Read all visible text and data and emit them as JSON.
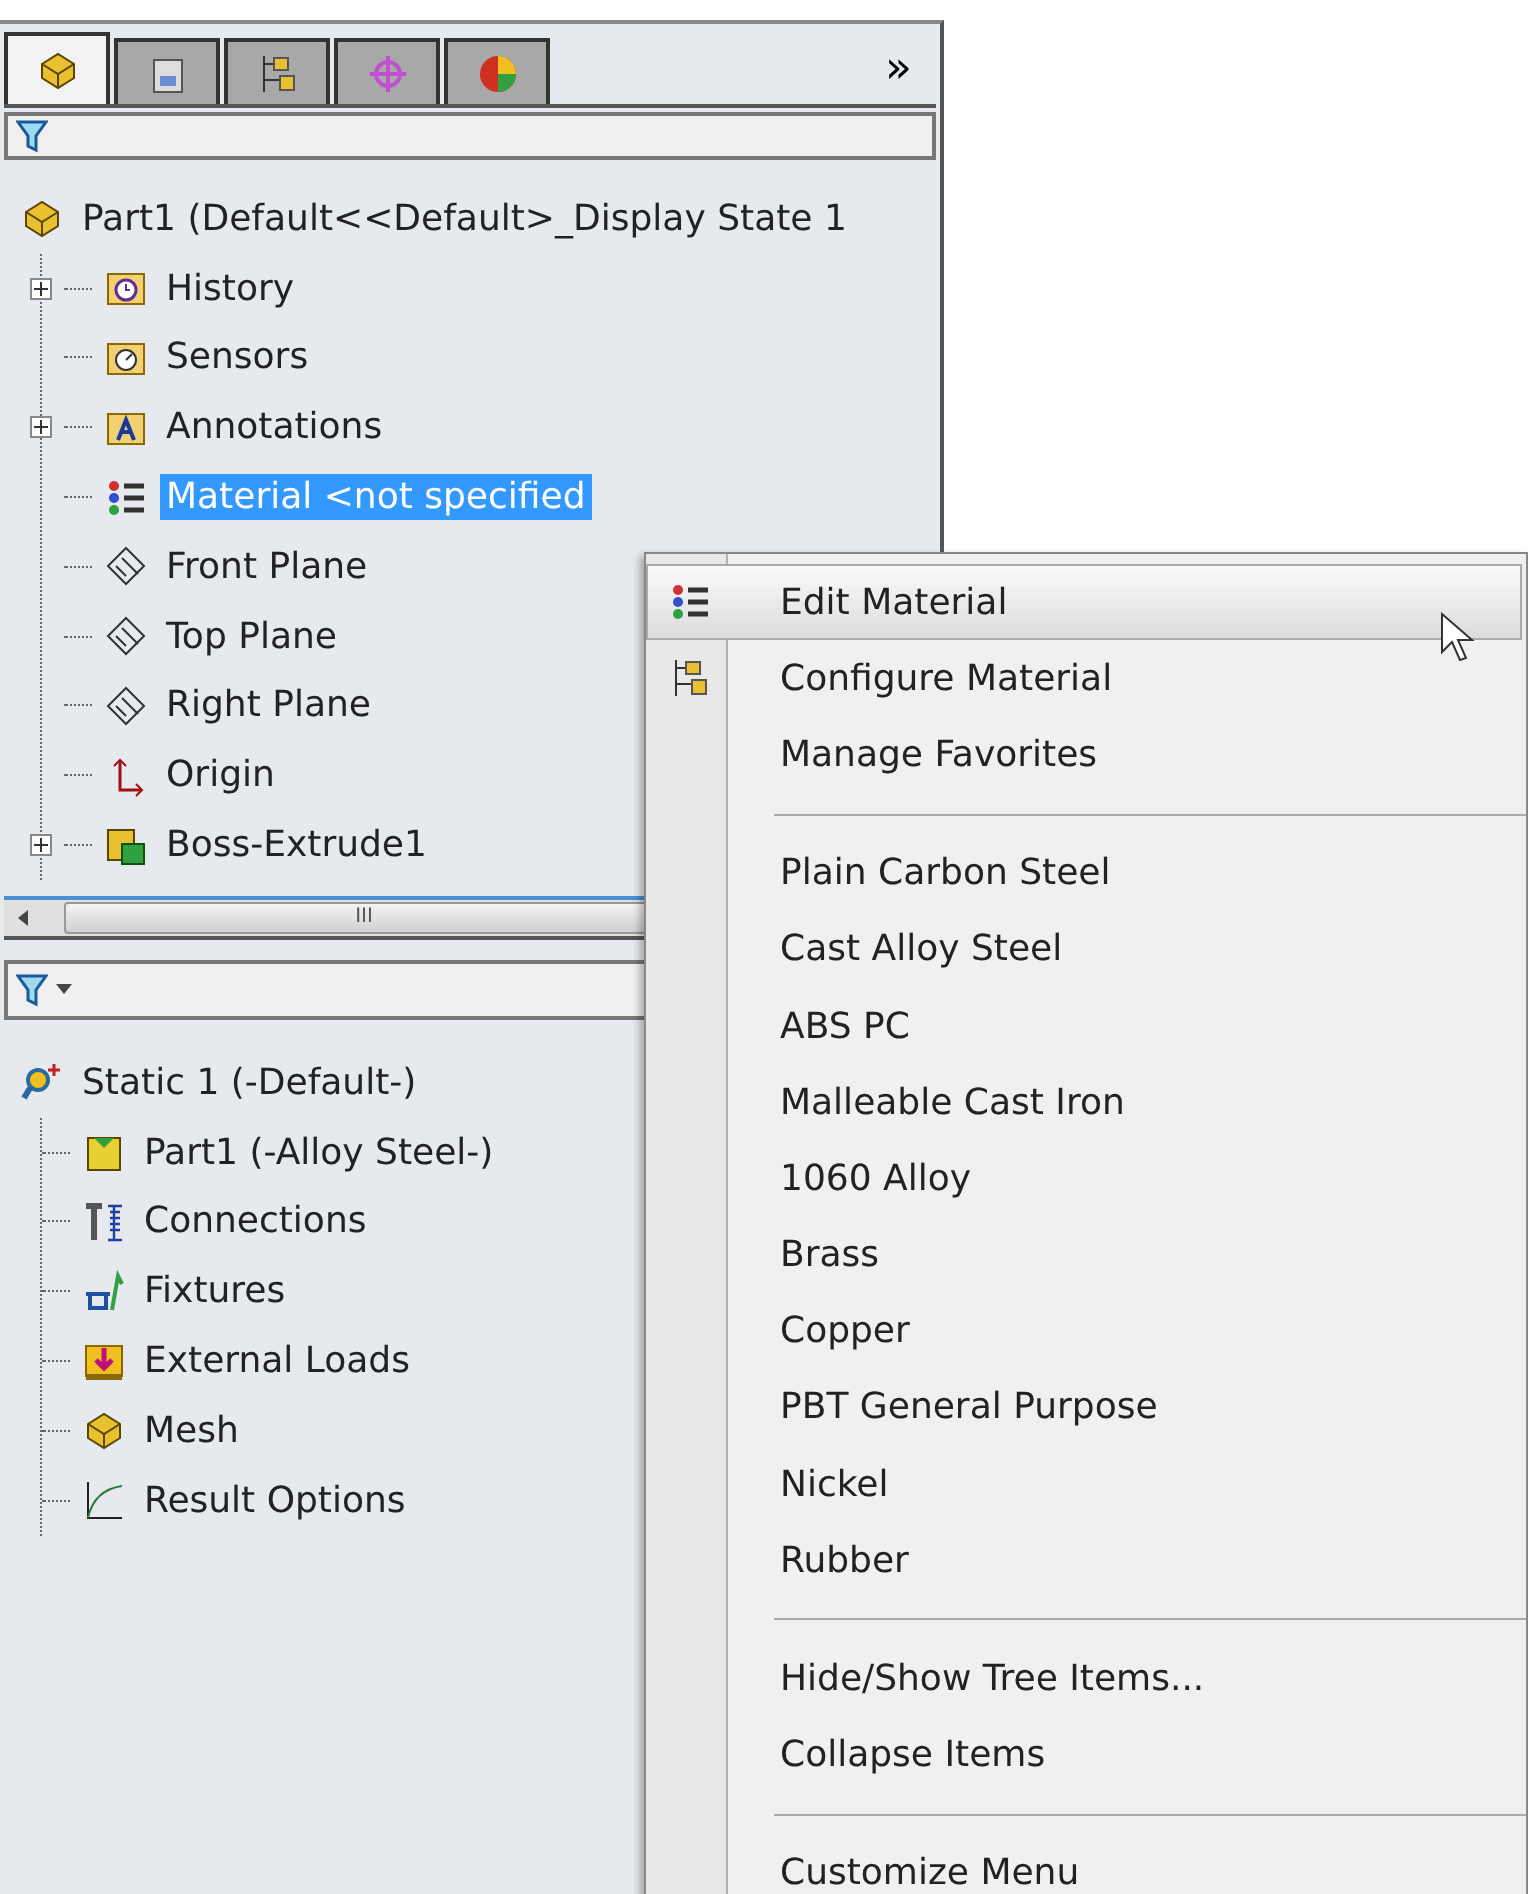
{
  "tabs": [
    {
      "kind": "block",
      "selected": true
    },
    {
      "kind": "clipboard",
      "selected": false
    },
    {
      "kind": "hierarchy",
      "selected": false
    },
    {
      "kind": "crosshair",
      "selected": false
    },
    {
      "kind": "sphere",
      "selected": false
    }
  ],
  "more_tabs": "»",
  "feature_tree": {
    "root": {
      "label": "Part1  (Default<<Default>_Display State 1",
      "kind": "block"
    },
    "children": [
      {
        "label": "History",
        "kind": "clock-folder",
        "expandable": true,
        "selected": false
      },
      {
        "label": "Sensors",
        "kind": "gauge-folder",
        "expandable": false,
        "selected": false
      },
      {
        "label": "Annotations",
        "kind": "letter-folder",
        "expandable": true,
        "selected": false
      },
      {
        "label": "Material <not specified",
        "kind": "list",
        "expandable": false,
        "selected": true
      },
      {
        "label": "Front Plane",
        "kind": "plane",
        "expandable": false,
        "selected": false
      },
      {
        "label": "Top Plane",
        "kind": "plane",
        "expandable": false,
        "selected": false
      },
      {
        "label": "Right Plane",
        "kind": "plane",
        "expandable": false,
        "selected": false
      },
      {
        "label": "Origin",
        "kind": "axes",
        "expandable": false,
        "selected": false
      },
      {
        "label": "Boss-Extrude1",
        "kind": "cube",
        "expandable": true,
        "selected": false
      }
    ]
  },
  "scrollbar_grip": "III",
  "study_tree": {
    "root": {
      "label": "Static 1 (-Default-)",
      "kind": "magnifier"
    },
    "children": [
      {
        "label": "Part1 (-Alloy Steel-)",
        "kind": "cup"
      },
      {
        "label": "Connections",
        "kind": "bolt-spring"
      },
      {
        "label": "Fixtures",
        "kind": "clamp"
      },
      {
        "label": "External Loads",
        "kind": "arrow-down"
      },
      {
        "label": "Mesh",
        "kind": "block"
      },
      {
        "label": "Result Options",
        "kind": "curve"
      }
    ]
  },
  "context_menu": {
    "groups": [
      [
        {
          "label": "Edit Material",
          "kind": "list",
          "selected": true
        },
        {
          "label": "Configure Material",
          "kind": "hierarchy",
          "selected": false
        },
        {
          "label": "Manage Favorites",
          "kind": "plain",
          "selected": false
        }
      ],
      [
        {
          "label": "Plain Carbon Steel",
          "kind": "plain",
          "selected": false
        },
        {
          "label": "Cast Alloy Steel",
          "kind": "plain",
          "selected": false
        },
        {
          "label": "ABS PC",
          "kind": "plain",
          "selected": false
        },
        {
          "label": "Malleable Cast Iron",
          "kind": "plain",
          "selected": false
        },
        {
          "label": "1060 Alloy",
          "kind": "plain",
          "selected": false
        },
        {
          "label": "Brass",
          "kind": "plain",
          "selected": false
        },
        {
          "label": "Copper",
          "kind": "plain",
          "selected": false
        },
        {
          "label": "PBT General Purpose",
          "kind": "plain",
          "selected": false
        },
        {
          "label": "Nickel",
          "kind": "plain",
          "selected": false
        },
        {
          "label": "Rubber",
          "kind": "plain",
          "selected": false
        }
      ],
      [
        {
          "label": "Hide/Show Tree Items...",
          "kind": "plain",
          "selected": false
        },
        {
          "label": "Collapse Items",
          "kind": "plain",
          "selected": false
        }
      ],
      [
        {
          "label": "Customize Menu",
          "kind": "plain",
          "selected": false
        }
      ]
    ]
  }
}
